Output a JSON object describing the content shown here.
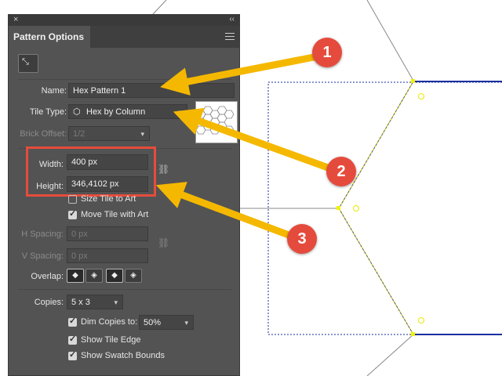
{
  "panel": {
    "close_glyph": "×",
    "collapse_glyph": "‹‹",
    "tab_title": "Pattern Options",
    "tool_icon": "pattern-tile-tool-icon",
    "name_label": "Name:",
    "name_value": "Hex Pattern 1",
    "tile_type_label": "Tile Type:",
    "tile_type_value": "Hex by Column",
    "brick_offset_label": "Brick Offset:",
    "brick_offset_value": "1/2",
    "width_label": "Width:",
    "width_value": "400 px",
    "height_label": "Height:",
    "height_value": "346,4102 px",
    "size_tile_label": "Size Tile to Art",
    "size_tile_checked": false,
    "move_tile_label": "Move Tile with Art",
    "move_tile_checked": true,
    "h_spacing_label": "H Spacing:",
    "h_spacing_value": "0 px",
    "v_spacing_label": "V Spacing:",
    "v_spacing_value": "0 px",
    "overlap_label": "Overlap:",
    "copies_label": "Copies:",
    "copies_value": "5 x 3",
    "dim_copies_label": "Dim Copies to:",
    "dim_copies_checked": true,
    "dim_copies_value": "50%",
    "show_tile_edge_label": "Show Tile Edge",
    "show_tile_edge_checked": true,
    "show_swatch_bounds_label": "Show Swatch Bounds",
    "show_swatch_bounds_checked": true
  },
  "callouts": [
    {
      "number": "1"
    },
    {
      "number": "2"
    },
    {
      "number": "3"
    }
  ],
  "colors": {
    "panel_bg": "#535353",
    "highlight": "#e74c3c",
    "arrow": "#f5b800",
    "badge": "#e54b3c",
    "tile_edge": "#1a2ea0"
  }
}
